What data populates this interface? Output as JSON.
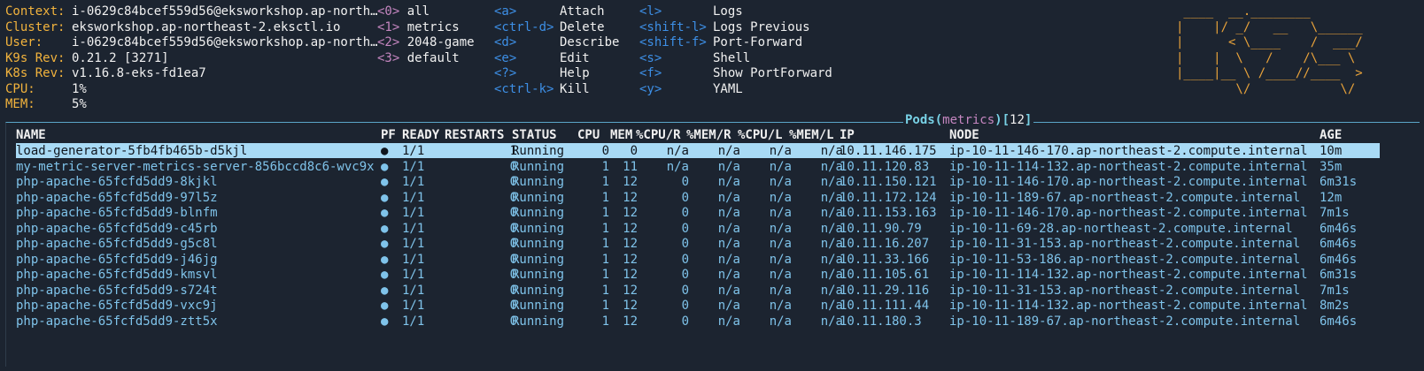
{
  "info": {
    "context_label": "Context:",
    "context": "i-0629c84bcef559d56@eksworkshop.ap-north…",
    "cluster_label": "Cluster:",
    "cluster": "eksworkshop.ap-northeast-2.eksctl.io",
    "user_label": "User:",
    "user": "i-0629c84bcef559d56@eksworkshop.ap-north…",
    "k9s_label": "K9s Rev:",
    "k9s_rev": "0.21.2 [3271]",
    "k8s_label": "K8s Rev:",
    "k8s_rev": "v1.16.8-eks-fd1ea7",
    "cpu_label": "CPU:",
    "cpu": "1%",
    "mem_label": "MEM:",
    "mem": "5%"
  },
  "namespaces": [
    {
      "key": "<0>",
      "name": "all"
    },
    {
      "key": "<1>",
      "name": "metrics"
    },
    {
      "key": "<2>",
      "name": "2048-game"
    },
    {
      "key": "<3>",
      "name": "default"
    }
  ],
  "shortcuts_col1": [
    {
      "key": "<a>",
      "action": "Attach"
    },
    {
      "key": "<ctrl-d>",
      "action": "Delete"
    },
    {
      "key": "<d>",
      "action": "Describe"
    },
    {
      "key": "<e>",
      "action": "Edit"
    },
    {
      "key": "<?>",
      "action": "Help"
    },
    {
      "key": "<ctrl-k>",
      "action": "Kill"
    }
  ],
  "shortcuts_col2": [
    {
      "key": "<l>",
      "action": "Logs"
    },
    {
      "key": "<shift-l>",
      "action": "Logs Previous"
    },
    {
      "key": "<shift-f>",
      "action": "Port-Forward"
    },
    {
      "key": "<s>",
      "action": "Shell"
    },
    {
      "key": "<f>",
      "action": "Show PortForward"
    },
    {
      "key": "<y>",
      "action": "YAML"
    }
  ],
  "logo_lines": [
    " ____  __.________       ",
    "|    |/ _/   __   \\______",
    "|      < \\____    /  ___/",
    "|    |  \\   /    /\\___ \\ ",
    "|____|__ \\ /____//____  >",
    "        \\/            \\/ "
  ],
  "panel": {
    "resource": "Pods",
    "namespace": "metrics",
    "count": "12"
  },
  "columns": [
    "NAME",
    "PF",
    "READY",
    "RESTARTS",
    "STATUS",
    "CPU",
    "MEM",
    "%CPU/R",
    "%MEM/R",
    "%CPU/L",
    "%MEM/L",
    "IP",
    "NODE",
    "AGE"
  ],
  "rows": [
    [
      "load-generator-5fb4fb465b-d5kjl",
      "●",
      "1/1",
      "1",
      "Running",
      "0",
      "0",
      "n/a",
      "n/a",
      "n/a",
      "n/a",
      "10.11.146.175",
      "ip-10-11-146-170.ap-northeast-2.compute.internal",
      "10m"
    ],
    [
      "my-metric-server-metrics-server-856bccd8c6-wvc9x",
      "●",
      "1/1",
      "0",
      "Running",
      "1",
      "11",
      "n/a",
      "n/a",
      "n/a",
      "n/a",
      "10.11.120.83",
      "ip-10-11-114-132.ap-northeast-2.compute.internal",
      "35m"
    ],
    [
      "php-apache-65fcfd5dd9-8kjkl",
      "●",
      "1/1",
      "0",
      "Running",
      "1",
      "12",
      "0",
      "n/a",
      "n/a",
      "n/a",
      "10.11.150.121",
      "ip-10-11-146-170.ap-northeast-2.compute.internal",
      "6m31s"
    ],
    [
      "php-apache-65fcfd5dd9-97l5z",
      "●",
      "1/1",
      "0",
      "Running",
      "1",
      "12",
      "0",
      "n/a",
      "n/a",
      "n/a",
      "10.11.172.124",
      "ip-10-11-189-67.ap-northeast-2.compute.internal",
      "12m"
    ],
    [
      "php-apache-65fcfd5dd9-blnfm",
      "●",
      "1/1",
      "0",
      "Running",
      "1",
      "12",
      "0",
      "n/a",
      "n/a",
      "n/a",
      "10.11.153.163",
      "ip-10-11-146-170.ap-northeast-2.compute.internal",
      "7m1s"
    ],
    [
      "php-apache-65fcfd5dd9-c45rb",
      "●",
      "1/1",
      "0",
      "Running",
      "1",
      "12",
      "0",
      "n/a",
      "n/a",
      "n/a",
      "10.11.90.79",
      "ip-10-11-69-28.ap-northeast-2.compute.internal",
      "6m46s"
    ],
    [
      "php-apache-65fcfd5dd9-g5c8l",
      "●",
      "1/1",
      "0",
      "Running",
      "1",
      "12",
      "0",
      "n/a",
      "n/a",
      "n/a",
      "10.11.16.207",
      "ip-10-11-31-153.ap-northeast-2.compute.internal",
      "6m46s"
    ],
    [
      "php-apache-65fcfd5dd9-j46jg",
      "●",
      "1/1",
      "0",
      "Running",
      "1",
      "12",
      "0",
      "n/a",
      "n/a",
      "n/a",
      "10.11.33.166",
      "ip-10-11-53-186.ap-northeast-2.compute.internal",
      "6m46s"
    ],
    [
      "php-apache-65fcfd5dd9-kmsvl",
      "●",
      "1/1",
      "0",
      "Running",
      "1",
      "12",
      "0",
      "n/a",
      "n/a",
      "n/a",
      "10.11.105.61",
      "ip-10-11-114-132.ap-northeast-2.compute.internal",
      "6m31s"
    ],
    [
      "php-apache-65fcfd5dd9-s724t",
      "●",
      "1/1",
      "0",
      "Running",
      "1",
      "12",
      "0",
      "n/a",
      "n/a",
      "n/a",
      "10.11.29.116",
      "ip-10-11-31-153.ap-northeast-2.compute.internal",
      "7m1s"
    ],
    [
      "php-apache-65fcfd5dd9-vxc9j",
      "●",
      "1/1",
      "0",
      "Running",
      "1",
      "12",
      "0",
      "n/a",
      "n/a",
      "n/a",
      "10.11.111.44",
      "ip-10-11-114-132.ap-northeast-2.compute.internal",
      "8m2s"
    ],
    [
      "php-apache-65fcfd5dd9-ztt5x",
      "●",
      "1/1",
      "0",
      "Running",
      "1",
      "12",
      "0",
      "n/a",
      "n/a",
      "n/a",
      "10.11.180.3",
      "ip-10-11-189-67.ap-northeast-2.compute.internal",
      "6m46s"
    ]
  ],
  "selected_row": 0,
  "colors": {
    "background": "#1c2430",
    "label": "#f2b33d",
    "namespace_key": "#c586c0",
    "shortcut_key": "#3d8fe6",
    "row_text": "#7fc3ea",
    "selected_row_bg": "#a8daf5",
    "title": "#78d2e6"
  }
}
